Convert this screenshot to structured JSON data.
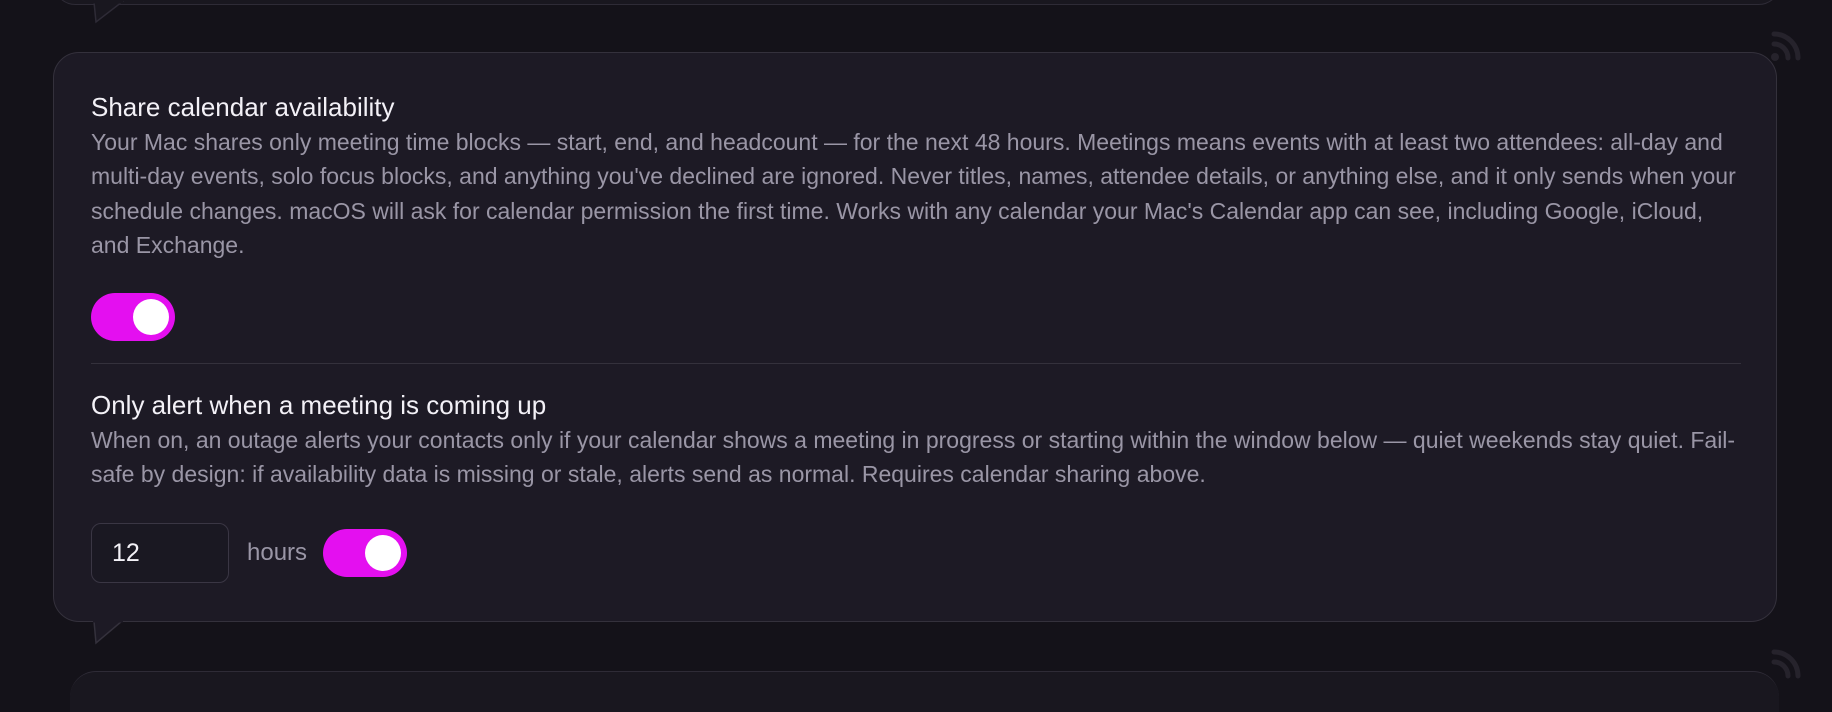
{
  "calendar_sharing": {
    "title": "Share calendar availability",
    "description": "Your Mac shares only meeting time blocks — start, end, and headcount — for the next 48 hours. Meetings means events with at least two attendees: all-day and multi-day events, solo focus blocks, and anything you've declined are ignored. Never titles, names, attendee details, or anything else, and it only sends when your schedule changes. macOS will ask for calendar permission the first time. Works with any calendar your Mac's Calendar app can see, including Google, iCloud, and Exchange.",
    "enabled": true
  },
  "meeting_alert": {
    "title": "Only alert when a meeting is coming up",
    "description": "When on, an outage alerts your contacts only if your calendar shows a meeting in progress or starting within the window below — quiet weekends stay quiet. Fail-safe by design: if availability data is missing or stale, alerts send as normal. Requires calendar sharing above.",
    "hours_value": "12",
    "hours_unit": "hours",
    "enabled": true
  },
  "colors": {
    "accent": "#e40ff0",
    "card_background": "#1d1a25",
    "page_background": "#141219"
  },
  "icons": [
    "feed-icon",
    "speech-tail-icon"
  ]
}
